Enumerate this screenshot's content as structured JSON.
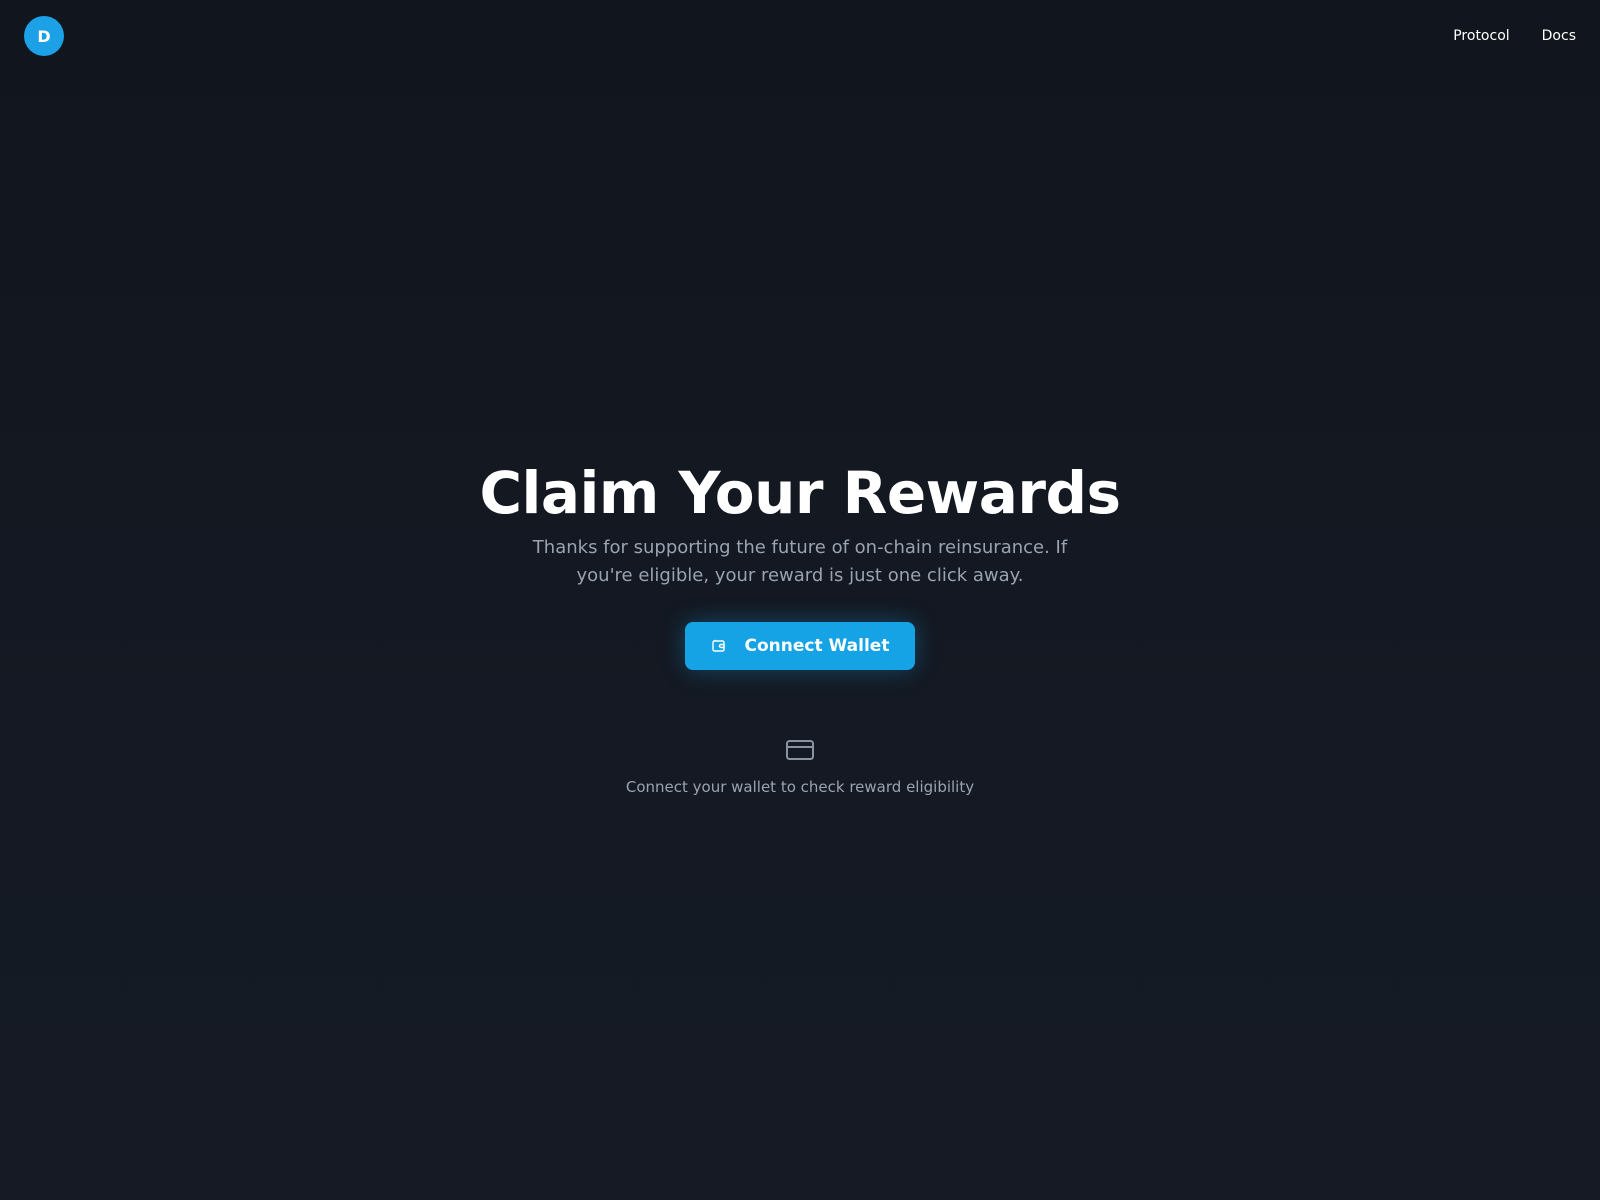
{
  "header": {
    "logo_letter": "D",
    "logo_color": "#1ca1e6",
    "nav": [
      {
        "label": "Protocol"
      },
      {
        "label": "Docs"
      }
    ]
  },
  "hero": {
    "title": "Claim Your Rewards",
    "subtitle": "Thanks for supporting the future of on-chain reinsurance. If you're eligible, your reward is just one click away.",
    "connect_button": {
      "label": "Connect Wallet",
      "icon": "wallet-icon",
      "color": "#16a3e6"
    },
    "status_icon": "credit-card-icon",
    "status_text": "Connect your wallet to check reward eligibility"
  },
  "colors": {
    "background": "#12161f",
    "muted_text": "#9aa3b2",
    "accent": "#16a3e6"
  }
}
